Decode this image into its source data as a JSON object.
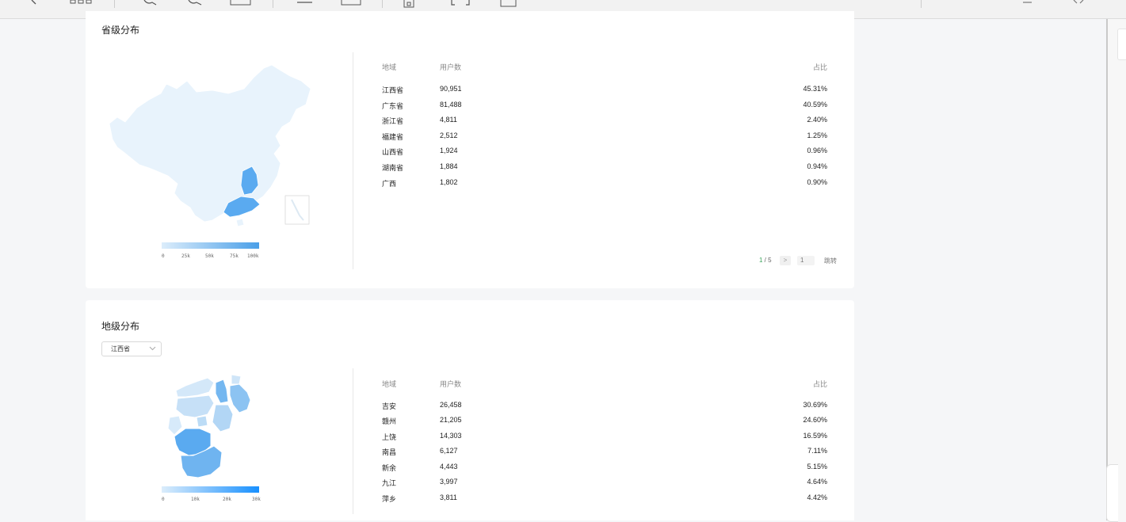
{
  "toolbar": {
    "icons": [
      "chevron-right-icon",
      "grid-icon",
      "zoom-in-icon",
      "zoom-out-icon",
      "page-icon",
      "page-icon",
      "page-icon",
      "bookmark-icon",
      "bracket-icon",
      "document-icon"
    ]
  },
  "province": {
    "title": "省级分布",
    "headers": {
      "region": "地域",
      "users": "用户数",
      "ratio": "占比"
    },
    "rows": [
      {
        "region": "江西省",
        "users": "90,951",
        "ratio": "45.31%"
      },
      {
        "region": "广东省",
        "users": "81,488",
        "ratio": "40.59%"
      },
      {
        "region": "浙江省",
        "users": "4,811",
        "ratio": "2.40%"
      },
      {
        "region": "福建省",
        "users": "2,512",
        "ratio": "1.25%"
      },
      {
        "region": "山西省",
        "users": "1,924",
        "ratio": "0.96%"
      },
      {
        "region": "湖南省",
        "users": "1,884",
        "ratio": "0.94%"
      },
      {
        "region": "广西",
        "users": "1,802",
        "ratio": "0.90%"
      }
    ],
    "legend": [
      "0",
      "25k",
      "50k",
      "75k",
      "100k"
    ],
    "pagination": {
      "current": "1",
      "sep": " / ",
      "total": "5",
      "next": ">",
      "page_value": "1",
      "jump_label": "跳转"
    }
  },
  "city": {
    "title": "地级分布",
    "select_value": "江西省",
    "headers": {
      "region": "地域",
      "users": "用户数",
      "ratio": "占比"
    },
    "rows": [
      {
        "region": "吉安",
        "users": "26,458",
        "ratio": "30.69%"
      },
      {
        "region": "赣州",
        "users": "21,205",
        "ratio": "24.60%"
      },
      {
        "region": "上饶",
        "users": "14,303",
        "ratio": "16.59%"
      },
      {
        "region": "南昌",
        "users": "6,127",
        "ratio": "7.11%"
      },
      {
        "region": "新余",
        "users": "4,443",
        "ratio": "5.15%"
      },
      {
        "region": "九江",
        "users": "3,997",
        "ratio": "4.64%"
      },
      {
        "region": "萍乡",
        "users": "3,811",
        "ratio": "4.42%"
      }
    ],
    "legend": [
      "0",
      "10k",
      "20k",
      "30k"
    ]
  },
  "colors": {
    "map_base": "#e8f3fc",
    "map_high": "#5aaaf0",
    "accent_green": "#3ba55c",
    "legend_from": "#dcedfb",
    "legend_to": "#4a9fe8",
    "legend2_to": "#1890ff"
  }
}
